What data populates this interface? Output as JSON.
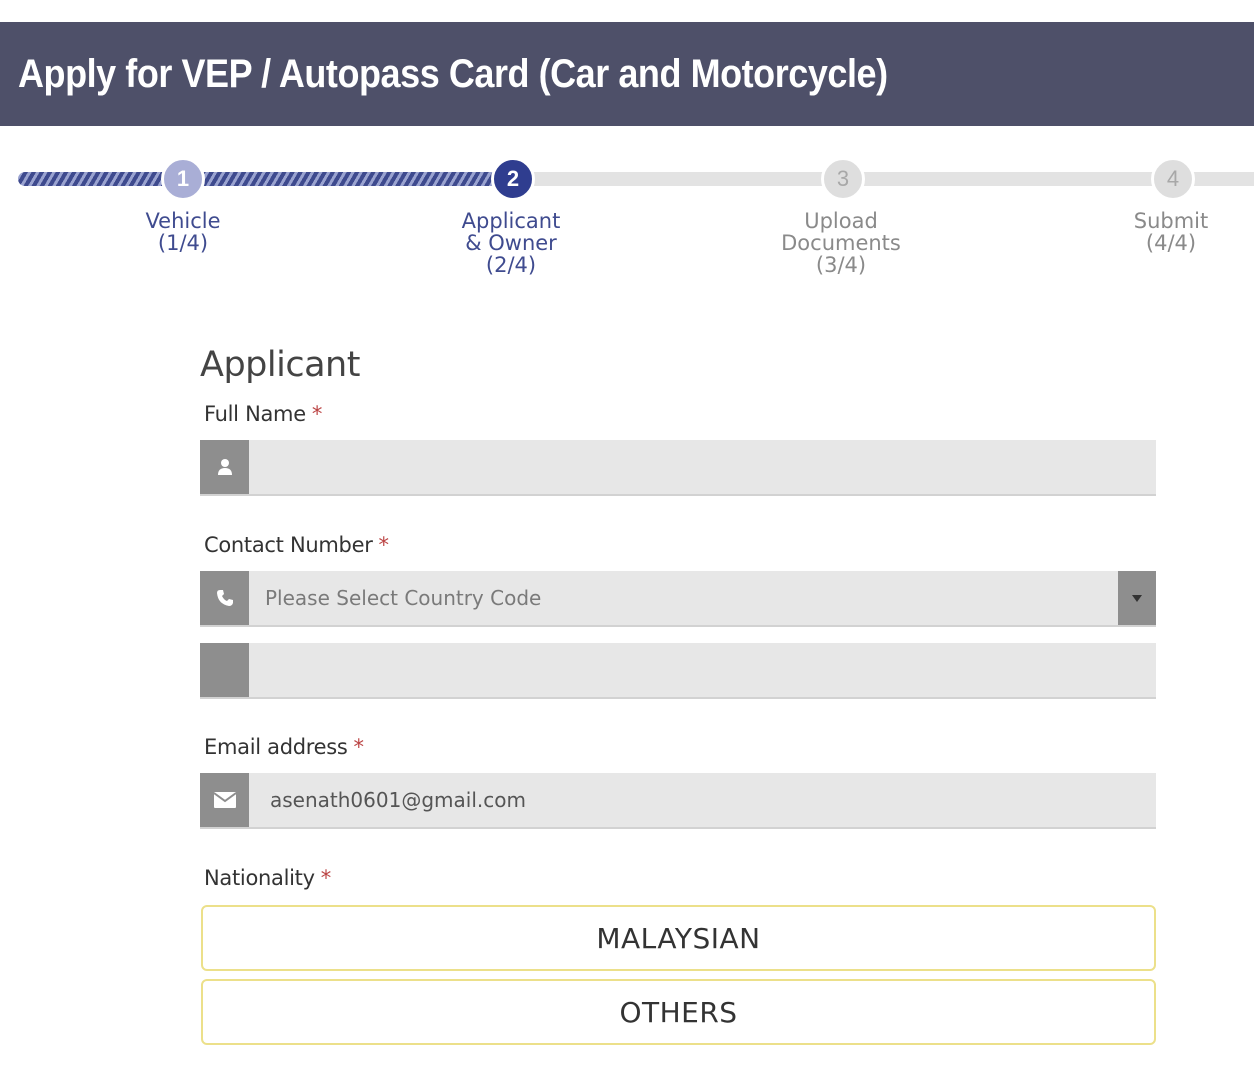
{
  "header": {
    "title": "Apply for VEP / Autopass Card (Car and Motorcycle)"
  },
  "stepper": {
    "steps": [
      {
        "number": "1",
        "line1": "Vehicle",
        "line2": "(1/4)",
        "line3": ""
      },
      {
        "number": "2",
        "line1": "Applicant",
        "line2": "& Owner",
        "line3": "(2/4)"
      },
      {
        "number": "3",
        "line1": "Upload",
        "line2": "Documents",
        "line3": "(3/4)"
      },
      {
        "number": "4",
        "line1": "Submit",
        "line2": "(4/4)",
        "line3": ""
      }
    ]
  },
  "form": {
    "section_title": "Applicant",
    "full_name": {
      "label": "Full Name",
      "required": "*",
      "value": ""
    },
    "contact": {
      "label": "Contact Number",
      "required": "*",
      "country_placeholder": "Please Select Country Code",
      "number_value": ""
    },
    "email": {
      "label": "Email address",
      "required": "*",
      "value": "asenath0601@gmail.com"
    },
    "nationality": {
      "label": "Nationality",
      "required": "*",
      "options": [
        "MALAYSIAN",
        "OTHERS"
      ]
    }
  },
  "icons": {
    "full_name": "user-icon",
    "contact": "phone-icon",
    "email": "envelope-icon",
    "dropdown": "caret-down-icon"
  },
  "colors": {
    "header_bg": "#4e5069",
    "step_active": "#2f3d8f",
    "step_done": "#a9aed6",
    "option_border": "#ece08a",
    "required": "#b44444"
  }
}
